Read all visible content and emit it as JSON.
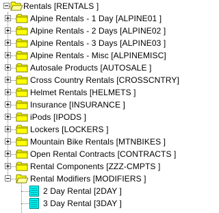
{
  "tree": {
    "root": {
      "label": "Rentals [RENTALS  ]",
      "expanded": true
    },
    "categories": [
      {
        "label": "Alpine Rentals - 1 Day [ALPINE01  ]",
        "expanded": false
      },
      {
        "label": "Alpine Rentals - 2 Days [ALPINE02  ]",
        "expanded": false
      },
      {
        "label": "Alpine Rentals - 3 Days [ALPINE03  ]",
        "expanded": false
      },
      {
        "label": "Alpine Rentals - Misc [ALPINEMISC]",
        "expanded": false
      },
      {
        "label": "Autosale Products [AUTOSALE  ]",
        "expanded": false
      },
      {
        "label": "Cross Country Rentals [CROSSCNTRY]",
        "expanded": false
      },
      {
        "label": "Helmet Rentals [HELMETS   ]",
        "expanded": false
      },
      {
        "label": "Insurance [INSURANCE ]",
        "expanded": false
      },
      {
        "label": "iPods [IPODS     ]",
        "expanded": false
      },
      {
        "label": "Lockers [LOCKERS   ]",
        "expanded": false
      },
      {
        "label": "Mountain Bike Rentals [MTNBIKES  ]",
        "expanded": false
      },
      {
        "label": "Open Rental Contracts [CONTRACTS ]",
        "expanded": false
      },
      {
        "label": "Rental Components [ZZZ-CMPTS ]",
        "expanded": false
      },
      {
        "label": "Rental Modifiers [MODIFIERS ]",
        "expanded": true
      }
    ],
    "modifiers": [
      {
        "label": "2 Day Rental [2DAY      ]"
      },
      {
        "label": "3 Day Rental [3DAY      ]"
      }
    ],
    "colors": {
      "folder_fill": "#ffff00",
      "folder_outline": "#808000",
      "doc_fill": "#00ffff",
      "doc_lines": "#008080"
    },
    "icons": {
      "folder": "folder-icon",
      "item": "document-icon",
      "expander": "expand-toggle-icon"
    }
  }
}
